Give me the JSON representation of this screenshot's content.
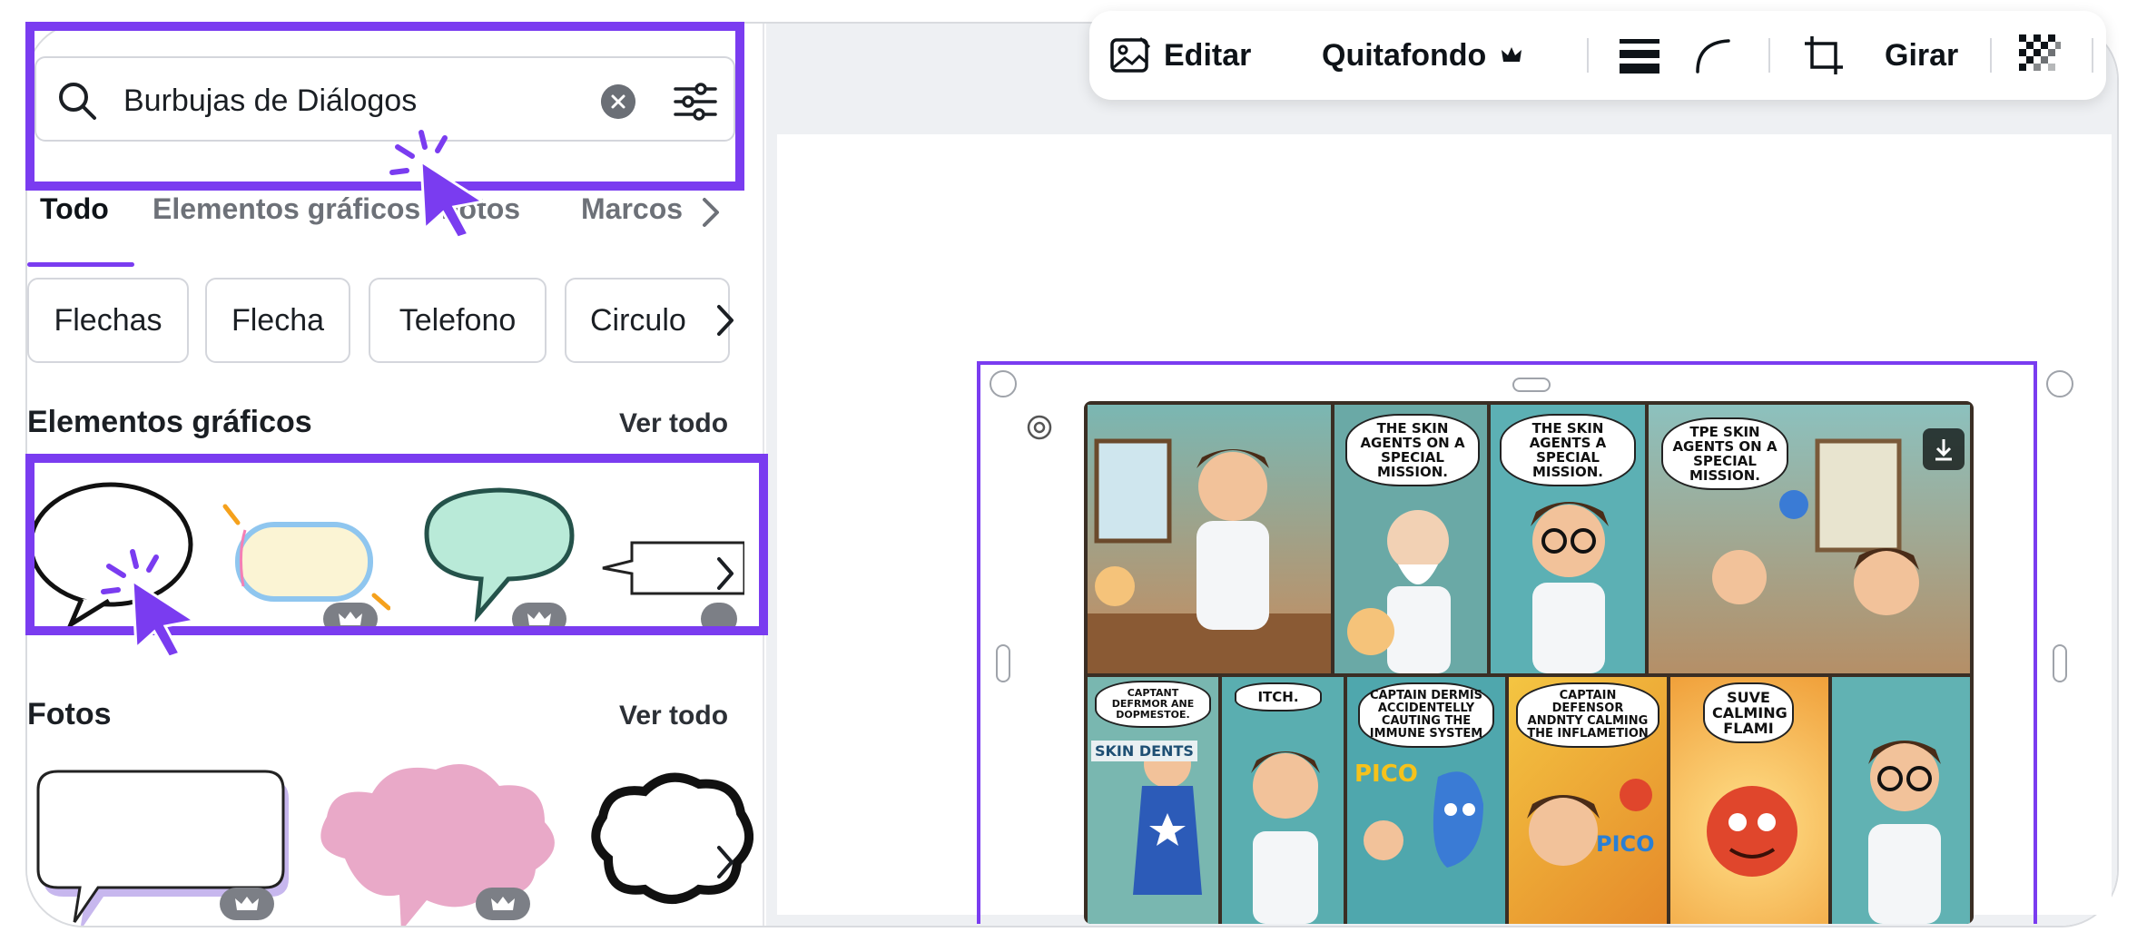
{
  "search": {
    "query": "Burbujas de Diálogos"
  },
  "tabs": [
    {
      "label": "Todo"
    },
    {
      "label": "Elementos gráficos"
    },
    {
      "label": "Fotos"
    },
    {
      "label": "Marcos"
    }
  ],
  "chips": [
    {
      "label": "Flechas"
    },
    {
      "label": "Flecha"
    },
    {
      "label": "Telefono"
    },
    {
      "label": "Circulo"
    }
  ],
  "graphics_section": {
    "title": "Elementos gráficos",
    "see_all": "Ver todo"
  },
  "photos_section": {
    "title": "Fotos",
    "see_all": "Ver todo"
  },
  "toolbar": {
    "edit_label": "Editar",
    "bg_remover_label": "Quitafondo",
    "rotate_label": "Girar"
  },
  "comic": {
    "bubbles": [
      "THE SKIN AGENTS ON A SPECIAL MISSION.",
      "THE SKIN AGENTS A SPECIAL MISSION.",
      "TPE SKIN AGENTS ON A SPECIAL MISSION.",
      "CAPTANT DEFRMOR ANE DOPMESTOE.",
      "ITCH.",
      "CAPTAIN DERMIS ACCIDENTELLY CAUTING THE IMMUNE SYSTEM",
      "CAPTAIN DEFENSOR ANDNTY CALMING THE INFLAMETION",
      "SUVE CALMING FLAMI"
    ],
    "labels": [
      "PICO",
      "PICO",
      "SKIN DENTS"
    ]
  },
  "colors": {
    "accent": "#7a3cf0",
    "canvas_bg": "#eef0f3",
    "badge_gray": "#7c7f86"
  }
}
